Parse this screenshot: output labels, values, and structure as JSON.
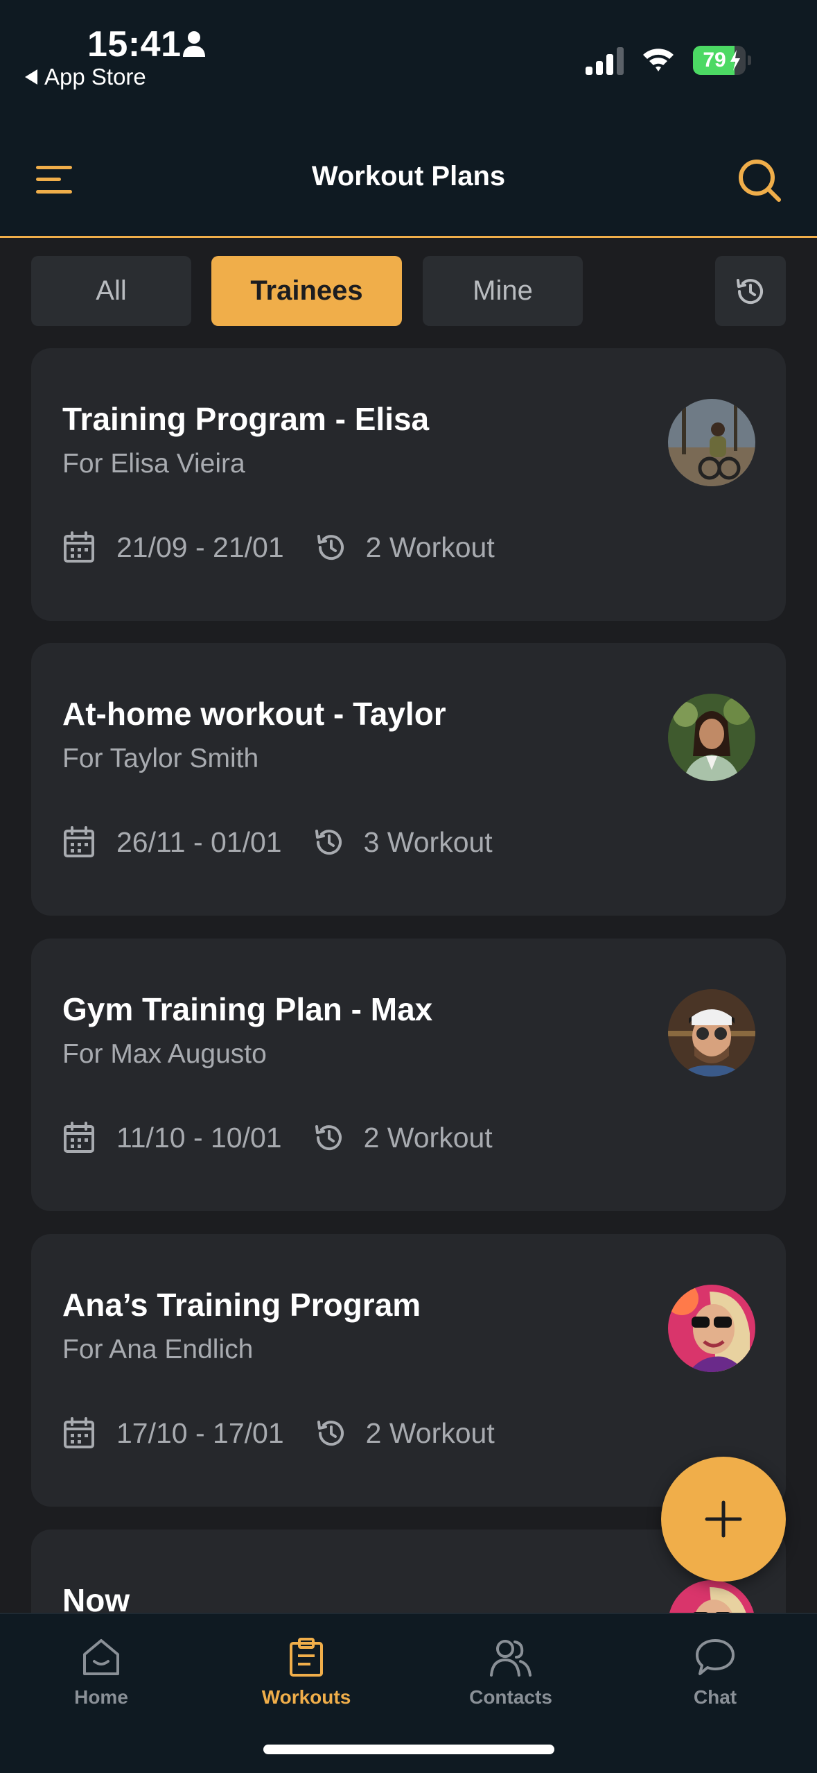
{
  "status_bar": {
    "time": "15:41",
    "back_label": "App Store",
    "battery": "79",
    "battery_level": 0.79
  },
  "header": {
    "title": "Workout Plans"
  },
  "tabs": [
    {
      "label": "All",
      "active": false
    },
    {
      "label": "Trainees",
      "active": true
    },
    {
      "label": "Mine",
      "active": false
    }
  ],
  "plans": [
    {
      "title": "Training Program - Elisa",
      "subtitle": "For Elisa Vieira",
      "dates": "21/09 - 21/01",
      "workouts": "2 Workout"
    },
    {
      "title": "At-home workout - Taylor",
      "subtitle": "For Taylor Smith",
      "dates": "26/11 - 01/01",
      "workouts": "3 Workout"
    },
    {
      "title": "Gym Training Plan - Max",
      "subtitle": "For Max Augusto",
      "dates": "11/10 - 10/01",
      "workouts": "2 Workout"
    },
    {
      "title": "Ana’s Training Program",
      "subtitle": "For Ana Endlich",
      "dates": "17/10 - 17/01",
      "workouts": "2 Workout"
    },
    {
      "title": "Now"
    }
  ],
  "bottom_nav": [
    {
      "label": "Home",
      "icon": "home-icon",
      "active": false
    },
    {
      "label": "Workouts",
      "icon": "clipboard-icon",
      "active": true
    },
    {
      "label": "Contacts",
      "icon": "contacts-icon",
      "active": false
    },
    {
      "label": "Chat",
      "icon": "chat-icon",
      "active": false
    }
  ],
  "colors": {
    "accent": "#f0ae4a",
    "header_bg": "#0f1a22",
    "card_bg": "#26282c",
    "page_bg": "#1c1d20"
  }
}
